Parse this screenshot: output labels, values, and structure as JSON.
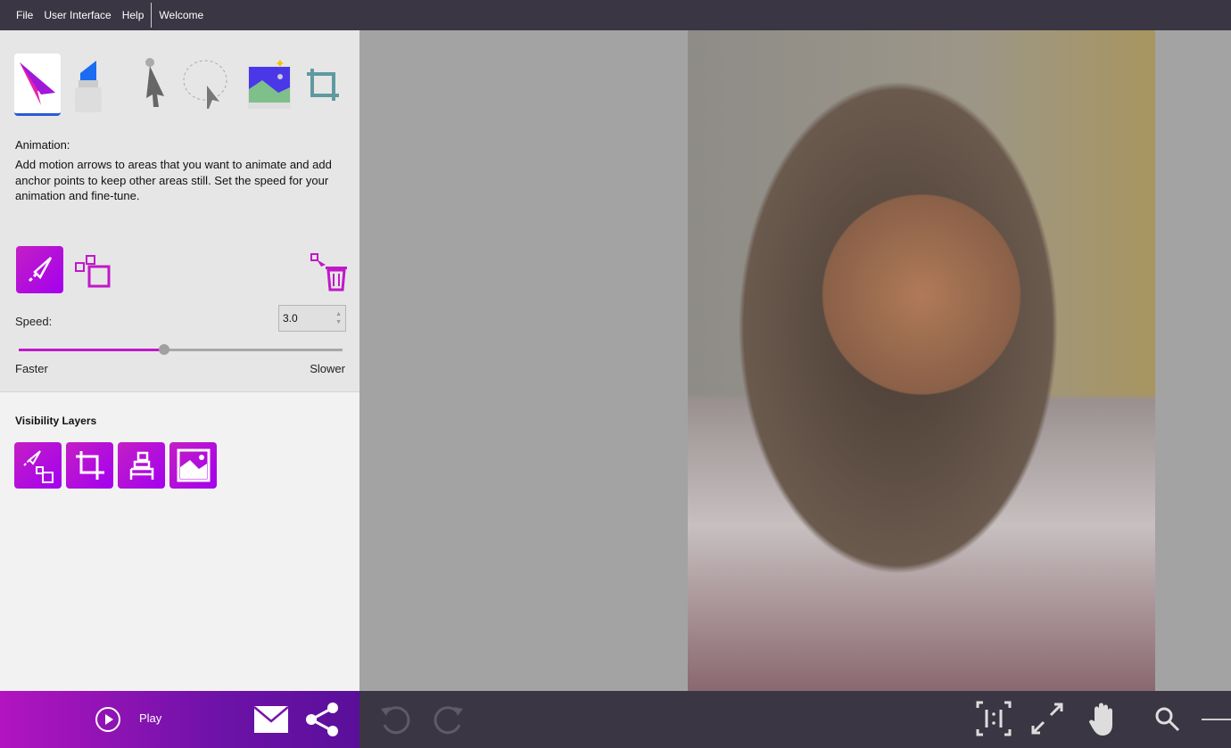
{
  "menu": {
    "items": [
      "File",
      "User Interface",
      "Help"
    ],
    "tab": "Welcome"
  },
  "tools": [
    "animation",
    "eraser-mask",
    "select-anchor",
    "lasso-select",
    "image-enhance",
    "crop"
  ],
  "panel": {
    "title": "Animation:",
    "description": "Add motion arrows to areas that you want to animate and add anchor points to keep other areas still. Set the speed for your animation and fine-tune.",
    "speed_label": "Speed:",
    "speed_value": "3.0",
    "speed_slider_percent": 45,
    "faster": "Faster",
    "slower": "Slower"
  },
  "visibility": {
    "title": "Visibility Layers"
  },
  "footer": {
    "play": "Play"
  },
  "colors": {
    "accent": "#b214c0",
    "bar": "#3a3644"
  }
}
